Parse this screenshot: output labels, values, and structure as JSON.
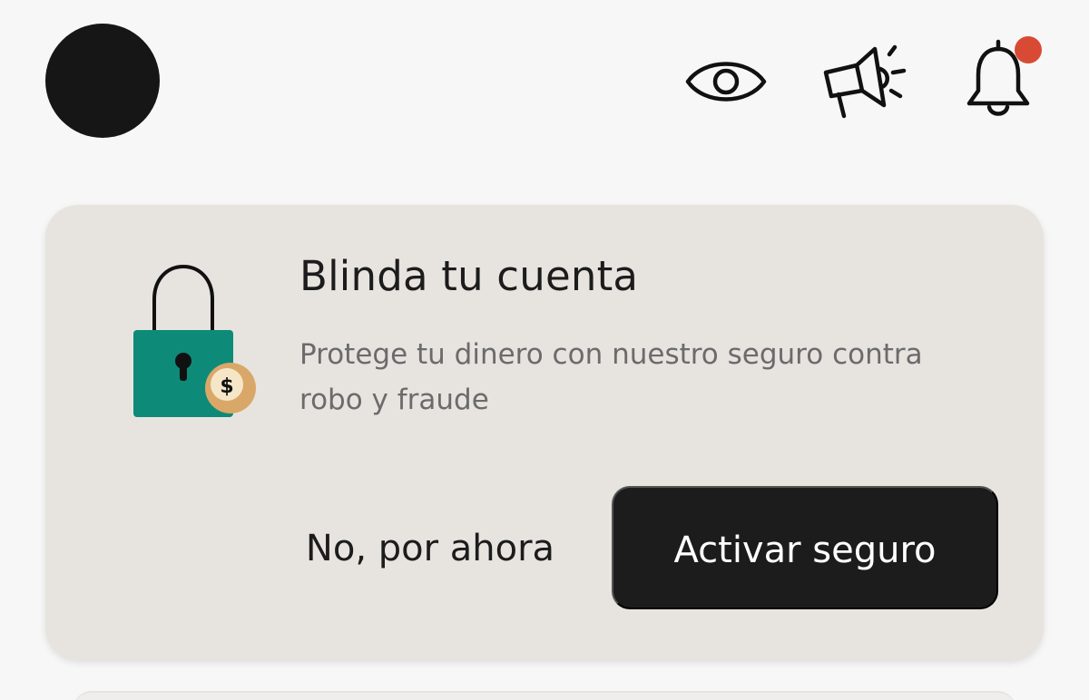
{
  "header": {
    "avatar": "avatar",
    "icons": [
      "eye-icon",
      "megaphone-icon",
      "bell-icon"
    ],
    "notification_dot_color": "#d94a34"
  },
  "card": {
    "illustration": "lock-with-coin-icon",
    "coin_symbol": "$",
    "title": "Blinda tu cuenta",
    "description": "Protege tu dinero con nuestro seguro contra robo y fraude",
    "secondary_button_label": "No, por ahora",
    "primary_button_label": "Activar seguro",
    "colors": {
      "card_background": "#e7e4e0",
      "lock_body": "#0e8a78",
      "coin": "#d9a868",
      "primary_button": "#1c1c1c"
    }
  }
}
